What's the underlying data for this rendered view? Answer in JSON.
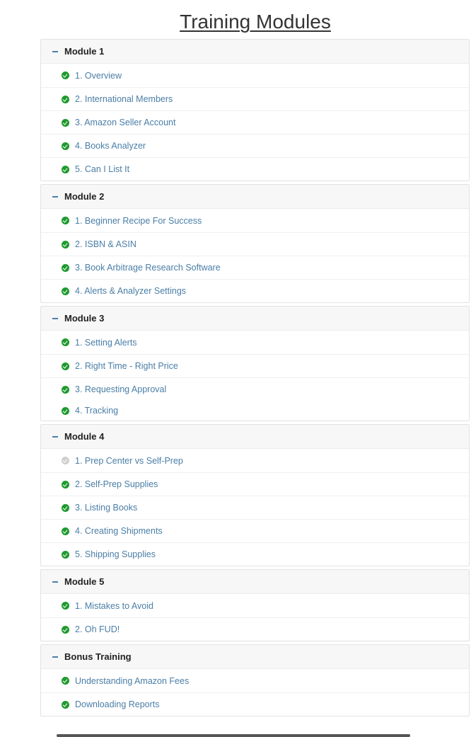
{
  "page": {
    "title": "Training Modules"
  },
  "colors": {
    "complete": "#1f9a2e",
    "pending": "#cfcfcf",
    "link": "#4a7ea6",
    "header_bg": "#f7f7f7"
  },
  "modules": [
    {
      "title": "Module 1",
      "lessons": [
        {
          "label": "1. Overview",
          "status": "complete"
        },
        {
          "label": "2. International Members",
          "status": "complete"
        },
        {
          "label": "3. Amazon Seller Account",
          "status": "complete"
        },
        {
          "label": "4. Books Analyzer",
          "status": "complete"
        },
        {
          "label": "5. Can I List It",
          "status": "complete"
        }
      ]
    },
    {
      "title": "Module 2",
      "lessons": [
        {
          "label": "1. Beginner Recipe For Success",
          "status": "complete"
        },
        {
          "label": "2. ISBN & ASIN",
          "status": "complete"
        },
        {
          "label": "3. Book Arbitrage Research Software",
          "status": "complete"
        },
        {
          "label": "4. Alerts & Analyzer Settings",
          "status": "complete"
        }
      ]
    },
    {
      "title": "Module 3",
      "lessons": [
        {
          "label": "1. Setting Alerts",
          "status": "complete"
        },
        {
          "label": "2. Right Time - Right Price",
          "status": "complete"
        },
        {
          "label": "3. Requesting Approval",
          "status": "complete"
        },
        {
          "label": "4. Tracking",
          "status": "complete"
        }
      ]
    },
    {
      "title": "Module 4",
      "lessons": [
        {
          "label": "1. Prep Center vs Self-Prep",
          "status": "pending"
        },
        {
          "label": "2. Self-Prep Supplies",
          "status": "complete"
        },
        {
          "label": "3. Listing Books",
          "status": "complete"
        },
        {
          "label": "4. Creating Shipments",
          "status": "complete"
        },
        {
          "label": "5. Shipping Supplies",
          "status": "complete"
        }
      ]
    },
    {
      "title": "Module 5",
      "lessons": [
        {
          "label": "1. Mistakes to Avoid",
          "status": "complete"
        },
        {
          "label": "2. Oh FUD!",
          "status": "complete"
        }
      ]
    },
    {
      "title": "Bonus Training",
      "lessons": [
        {
          "label": "Understanding Amazon Fees",
          "status": "complete"
        },
        {
          "label": "Downloading Reports",
          "status": "complete"
        }
      ]
    }
  ]
}
